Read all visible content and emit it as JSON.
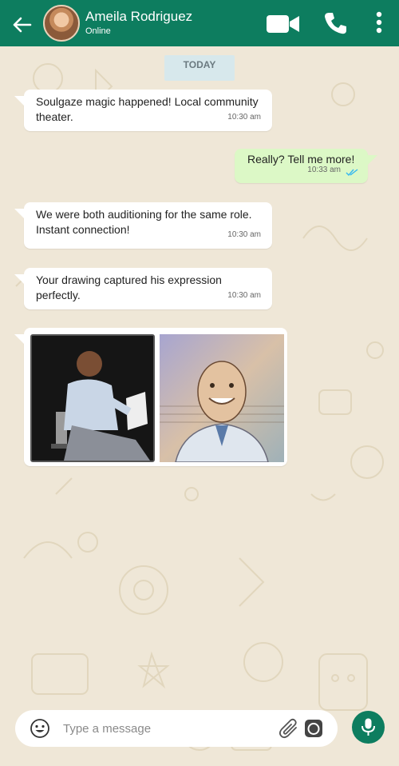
{
  "header": {
    "contact_name": "Ameila Rodriguez",
    "status": "Online",
    "icons": [
      "back-arrow-icon",
      "video-camera-icon",
      "phone-icon",
      "more-vertical-icon"
    ]
  },
  "chat": {
    "date_label": "TODAY",
    "messages": [
      {
        "direction": "incoming",
        "text": "Soulgaze magic happened! Local community theater.",
        "time": "10:30 am"
      },
      {
        "direction": "outgoing",
        "text": "Really? Tell me more!",
        "time": "10:33 am",
        "read": true
      },
      {
        "direction": "incoming",
        "text": "We were both auditioning for the same role. Instant connection!",
        "time": "10:30 am"
      },
      {
        "direction": "incoming",
        "text": "Your drawing captured his expression perfectly.",
        "time": "10:30 am"
      },
      {
        "direction": "incoming",
        "type": "images",
        "images": [
          "photo of man reading script on stage",
          "sketch portrait of smiling man"
        ]
      }
    ]
  },
  "composer": {
    "placeholder": "Type a message",
    "icons": [
      "emoji-icon",
      "paperclip-icon",
      "camera-icon",
      "microphone-icon"
    ]
  },
  "colors": {
    "header": "#0d7d5f",
    "outgoing_bubble": "#dcf8c6",
    "incoming_bubble": "#ffffff",
    "background": "#efe7d7",
    "read_ticks": "#34b7f1"
  }
}
